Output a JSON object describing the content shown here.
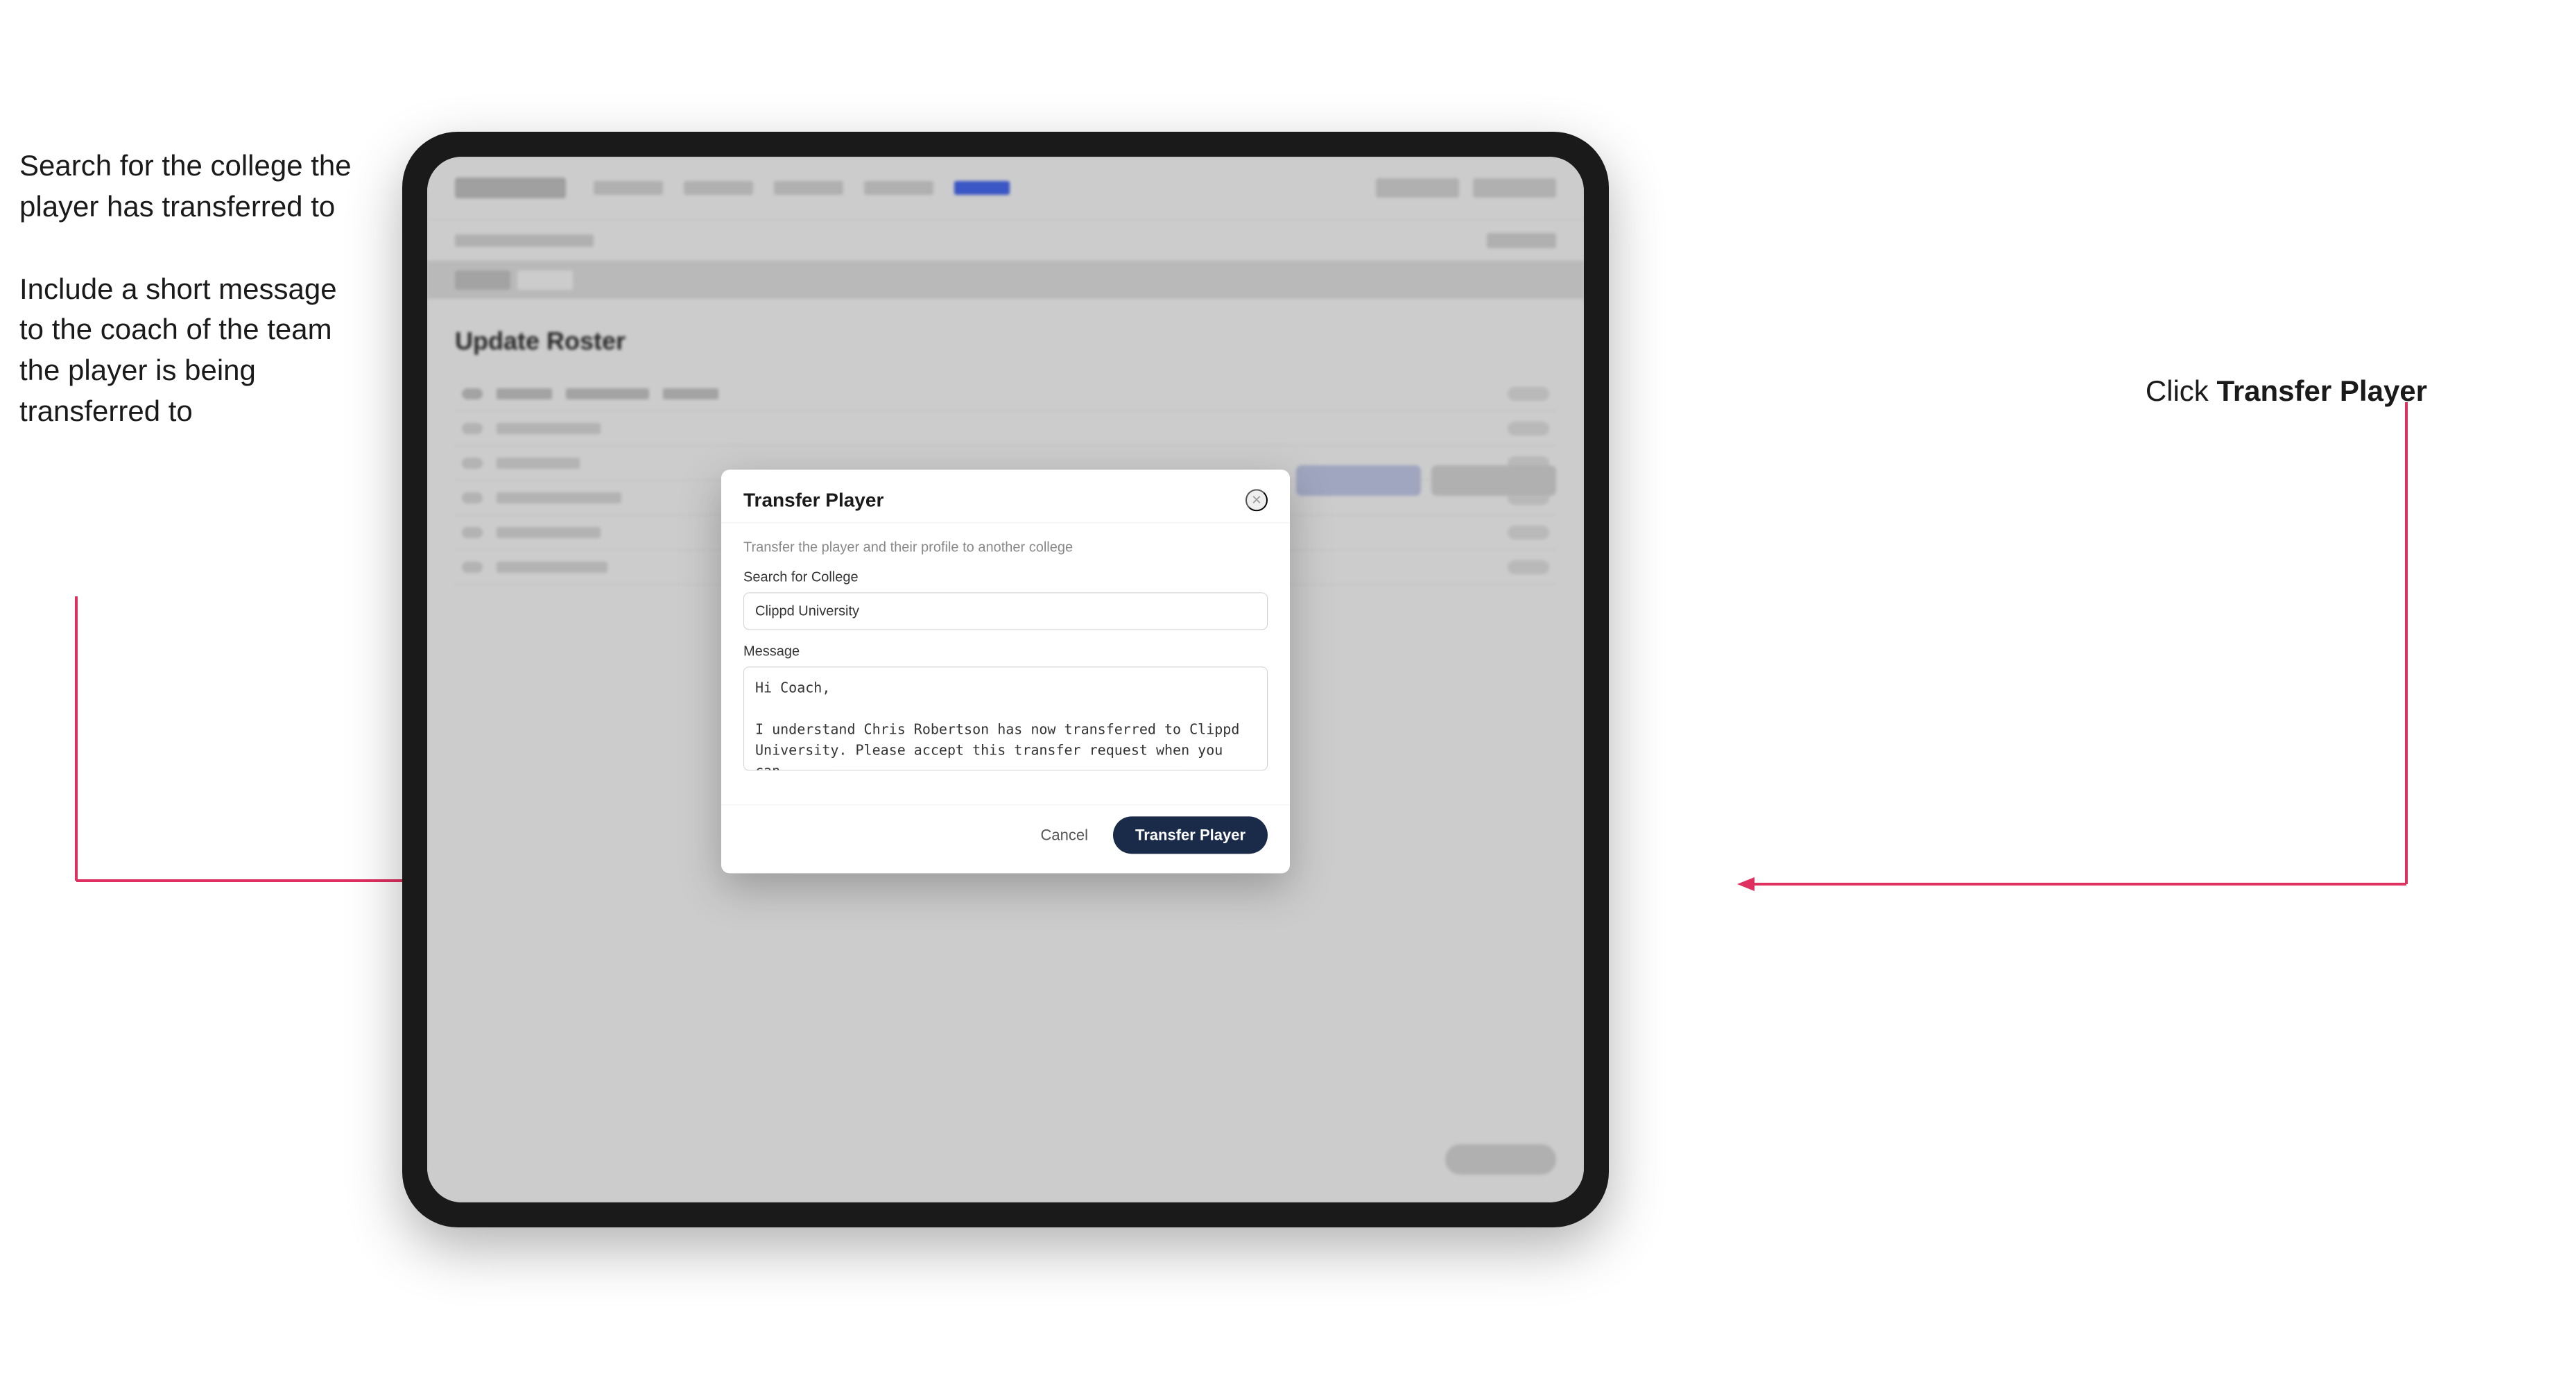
{
  "annotations": {
    "left_text_1": "Search for the college the\nplayer has transferred to",
    "left_text_2": "Include a short message\nto the coach of the team\nthe player is being\ntransferred to",
    "right_text_prefix": "Click ",
    "right_text_bold": "Transfer Player"
  },
  "modal": {
    "title": "Transfer Player",
    "subtitle": "Transfer the player and their profile to another college",
    "search_label": "Search for College",
    "search_value": "Clippd University",
    "message_label": "Message",
    "message_value": "Hi Coach,\n\nI understand Chris Robertson has now transferred to Clippd University. Please accept this transfer request when you can.",
    "cancel_label": "Cancel",
    "transfer_label": "Transfer Player",
    "close_label": "×"
  },
  "app": {
    "page_title": "Update Roster"
  },
  "colors": {
    "transfer_btn_bg": "#1a2b4a",
    "accent": "#4a6cf7",
    "arrow": "#e03060"
  }
}
